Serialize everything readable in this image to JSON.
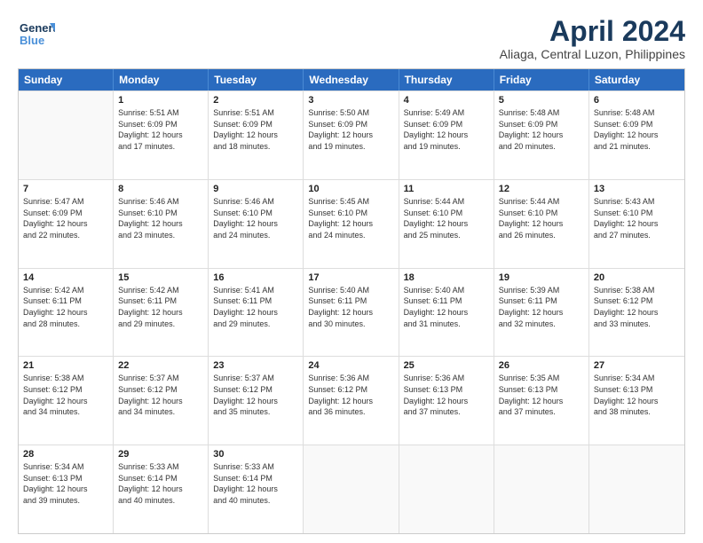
{
  "logo": {
    "line1": "General",
    "line2": "Blue"
  },
  "title": "April 2024",
  "location": "Aliaga, Central Luzon, Philippines",
  "weekdays": [
    "Sunday",
    "Monday",
    "Tuesday",
    "Wednesday",
    "Thursday",
    "Friday",
    "Saturday"
  ],
  "weeks": [
    [
      {
        "day": "",
        "info": ""
      },
      {
        "day": "1",
        "info": "Sunrise: 5:51 AM\nSunset: 6:09 PM\nDaylight: 12 hours\nand 17 minutes."
      },
      {
        "day": "2",
        "info": "Sunrise: 5:51 AM\nSunset: 6:09 PM\nDaylight: 12 hours\nand 18 minutes."
      },
      {
        "day": "3",
        "info": "Sunrise: 5:50 AM\nSunset: 6:09 PM\nDaylight: 12 hours\nand 19 minutes."
      },
      {
        "day": "4",
        "info": "Sunrise: 5:49 AM\nSunset: 6:09 PM\nDaylight: 12 hours\nand 19 minutes."
      },
      {
        "day": "5",
        "info": "Sunrise: 5:48 AM\nSunset: 6:09 PM\nDaylight: 12 hours\nand 20 minutes."
      },
      {
        "day": "6",
        "info": "Sunrise: 5:48 AM\nSunset: 6:09 PM\nDaylight: 12 hours\nand 21 minutes."
      }
    ],
    [
      {
        "day": "7",
        "info": "Sunrise: 5:47 AM\nSunset: 6:09 PM\nDaylight: 12 hours\nand 22 minutes."
      },
      {
        "day": "8",
        "info": "Sunrise: 5:46 AM\nSunset: 6:10 PM\nDaylight: 12 hours\nand 23 minutes."
      },
      {
        "day": "9",
        "info": "Sunrise: 5:46 AM\nSunset: 6:10 PM\nDaylight: 12 hours\nand 24 minutes."
      },
      {
        "day": "10",
        "info": "Sunrise: 5:45 AM\nSunset: 6:10 PM\nDaylight: 12 hours\nand 24 minutes."
      },
      {
        "day": "11",
        "info": "Sunrise: 5:44 AM\nSunset: 6:10 PM\nDaylight: 12 hours\nand 25 minutes."
      },
      {
        "day": "12",
        "info": "Sunrise: 5:44 AM\nSunset: 6:10 PM\nDaylight: 12 hours\nand 26 minutes."
      },
      {
        "day": "13",
        "info": "Sunrise: 5:43 AM\nSunset: 6:10 PM\nDaylight: 12 hours\nand 27 minutes."
      }
    ],
    [
      {
        "day": "14",
        "info": "Sunrise: 5:42 AM\nSunset: 6:11 PM\nDaylight: 12 hours\nand 28 minutes."
      },
      {
        "day": "15",
        "info": "Sunrise: 5:42 AM\nSunset: 6:11 PM\nDaylight: 12 hours\nand 29 minutes."
      },
      {
        "day": "16",
        "info": "Sunrise: 5:41 AM\nSunset: 6:11 PM\nDaylight: 12 hours\nand 29 minutes."
      },
      {
        "day": "17",
        "info": "Sunrise: 5:40 AM\nSunset: 6:11 PM\nDaylight: 12 hours\nand 30 minutes."
      },
      {
        "day": "18",
        "info": "Sunrise: 5:40 AM\nSunset: 6:11 PM\nDaylight: 12 hours\nand 31 minutes."
      },
      {
        "day": "19",
        "info": "Sunrise: 5:39 AM\nSunset: 6:11 PM\nDaylight: 12 hours\nand 32 minutes."
      },
      {
        "day": "20",
        "info": "Sunrise: 5:38 AM\nSunset: 6:12 PM\nDaylight: 12 hours\nand 33 minutes."
      }
    ],
    [
      {
        "day": "21",
        "info": "Sunrise: 5:38 AM\nSunset: 6:12 PM\nDaylight: 12 hours\nand 34 minutes."
      },
      {
        "day": "22",
        "info": "Sunrise: 5:37 AM\nSunset: 6:12 PM\nDaylight: 12 hours\nand 34 minutes."
      },
      {
        "day": "23",
        "info": "Sunrise: 5:37 AM\nSunset: 6:12 PM\nDaylight: 12 hours\nand 35 minutes."
      },
      {
        "day": "24",
        "info": "Sunrise: 5:36 AM\nSunset: 6:12 PM\nDaylight: 12 hours\nand 36 minutes."
      },
      {
        "day": "25",
        "info": "Sunrise: 5:36 AM\nSunset: 6:13 PM\nDaylight: 12 hours\nand 37 minutes."
      },
      {
        "day": "26",
        "info": "Sunrise: 5:35 AM\nSunset: 6:13 PM\nDaylight: 12 hours\nand 37 minutes."
      },
      {
        "day": "27",
        "info": "Sunrise: 5:34 AM\nSunset: 6:13 PM\nDaylight: 12 hours\nand 38 minutes."
      }
    ],
    [
      {
        "day": "28",
        "info": "Sunrise: 5:34 AM\nSunset: 6:13 PM\nDaylight: 12 hours\nand 39 minutes."
      },
      {
        "day": "29",
        "info": "Sunrise: 5:33 AM\nSunset: 6:14 PM\nDaylight: 12 hours\nand 40 minutes."
      },
      {
        "day": "30",
        "info": "Sunrise: 5:33 AM\nSunset: 6:14 PM\nDaylight: 12 hours\nand 40 minutes."
      },
      {
        "day": "",
        "info": ""
      },
      {
        "day": "",
        "info": ""
      },
      {
        "day": "",
        "info": ""
      },
      {
        "day": "",
        "info": ""
      }
    ]
  ]
}
